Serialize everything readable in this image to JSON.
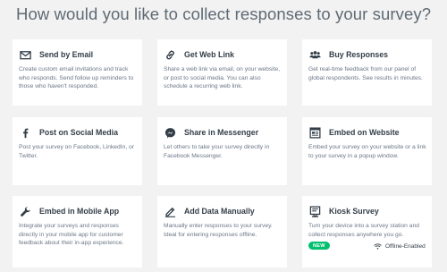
{
  "page_title": "How would you like to collect responses to your survey?",
  "options": [
    {
      "label": "Send by Email",
      "icon": "envelope-icon",
      "description": "Create custom email invitations and track who responds. Send follow up reminders to those who haven't responded."
    },
    {
      "label": "Get Web Link",
      "icon": "link-icon",
      "description": "Share a web link via email, on your website, or post to social media. You can also schedule a recurring web link."
    },
    {
      "label": "Buy Responses",
      "icon": "people-group-icon",
      "description": "Get real-time feedback from our panel of global respondents. See results in minutes."
    },
    {
      "label": "Post on Social Media",
      "icon": "facebook-icon",
      "description": "Post your survey on Facebook, LinkedIn, or Twitter."
    },
    {
      "label": "Share in Messenger",
      "icon": "messenger-icon",
      "description": "Let others to take your survey directly in Facebook Messenger."
    },
    {
      "label": "Embed on Website",
      "icon": "embed-window-icon",
      "description": "Embed your survey on your website or a link to your survey in a popup window."
    },
    {
      "label": "Embed in Mobile App",
      "icon": "wrench-icon",
      "description": "Integrate your surveys and responses directly in your mobile app for customer feedback about their in-app experience."
    },
    {
      "label": "Add Data Manually",
      "icon": "pencil-icon",
      "description": "Manually enter responses to your survey. Ideal for entering responses offline."
    },
    {
      "label": "Kiosk Survey",
      "icon": "kiosk-icon",
      "description": "Turn your device into a survey station and collect responses anywhere you go.",
      "badge": "NEW",
      "extra": "Offline-Enabled"
    }
  ],
  "colors": {
    "background": "#f2f2f3",
    "card": "#ffffff",
    "text": "#333e48",
    "muted": "#6b7787",
    "badge": "#00bf6f"
  }
}
